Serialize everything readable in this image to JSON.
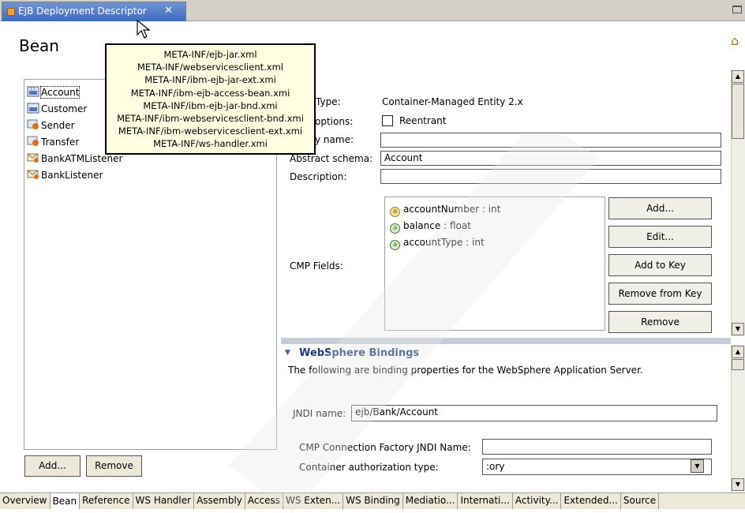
{
  "window": {
    "tab_title": "EJB Deployment Descriptor",
    "close_glyph": "✕"
  },
  "page": {
    "title": "Bean"
  },
  "beans": {
    "items": [
      {
        "label": "Account",
        "icon": "entity-bean-icon",
        "selected": true
      },
      {
        "label": "Customer",
        "icon": "entity-bean-icon",
        "selected": false
      },
      {
        "label": "Sender",
        "icon": "session-bean-icon",
        "selected": false
      },
      {
        "label": "Transfer",
        "icon": "session-bean-icon",
        "selected": false
      },
      {
        "label": "BankATMListener",
        "icon": "message-bean-icon",
        "selected": false
      },
      {
        "label": "BankListener",
        "icon": "message-bean-icon",
        "selected": false
      }
    ],
    "add_label": "Add...",
    "remove_label": "Remove"
  },
  "details": {
    "bean_type_label": "Type:",
    "bean_type_value": "Container-Managed Entity 2.x",
    "options_label": "options:",
    "reentrant_label": "Reentrant",
    "display_name_label": "y name:",
    "display_name_value": "",
    "abstract_schema_label": "Abstract schema:",
    "abstract_schema_value": "Account",
    "description_label": "Description:",
    "description_value": "",
    "cmp_fields_label": "CMP Fields:",
    "cmp_fields": [
      {
        "label": "accountNumber : int",
        "icon": "key-attribute-icon"
      },
      {
        "label": "balance : float",
        "icon": "attribute-icon"
      },
      {
        "label": "accountType : int",
        "icon": "attribute-icon"
      }
    ],
    "buttons": {
      "add": "Add...",
      "edit": "Edit...",
      "add_to_key": "Add to Key",
      "remove_from_key": "Remove from Key",
      "remove": "Remove"
    }
  },
  "bindings": {
    "title": "WebSphere Bindings",
    "description": "The following are binding properties for the WebSphere Application Server.",
    "jndi_label": "JNDI name:",
    "jndi_value": "ejb/Bank/Account",
    "cmp_factory_label": "CMP Connection Factory JNDI Name:",
    "cmp_factory_value": "",
    "container_auth_label": "Container authorization type:",
    "container_auth_value": ":ory"
  },
  "tooltip": {
    "lines": [
      "META-INF/ejb-jar.xml",
      "META-INF/webservicesclient.xml",
      "META-INF/ibm-ejb-jar-ext.xmi",
      "META-INF/ibm-ejb-access-bean.xmi",
      "META-INF/ibm-ejb-jar-bnd.xmi",
      "META-INF/ibm-webservicesclient-bnd.xmi",
      "META-INF/ibm-webservicesclient-ext.xmi",
      "META-INF/ws-handler.xmi"
    ]
  },
  "bottom_tabs": [
    {
      "label": "Overview",
      "active": false
    },
    {
      "label": "Bean",
      "active": true
    },
    {
      "label": "Reference",
      "active": false
    },
    {
      "label": "WS Handler",
      "active": false
    },
    {
      "label": "Assembly",
      "active": false
    },
    {
      "label": "Access",
      "active": false
    },
    {
      "label": "WS Exten...",
      "active": false
    },
    {
      "label": "WS Binding",
      "active": false
    },
    {
      "label": "Mediatio...",
      "active": false
    },
    {
      "label": "Internati...",
      "active": false
    },
    {
      "label": "Activity...",
      "active": false
    },
    {
      "label": "Extended...",
      "active": false
    },
    {
      "label": "Source",
      "active": false
    }
  ]
}
